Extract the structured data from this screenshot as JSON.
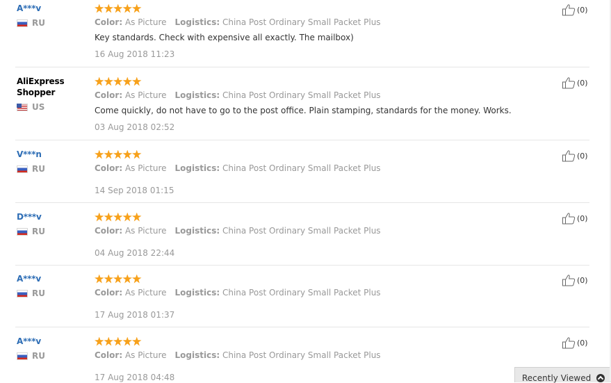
{
  "feedback": [
    {
      "user": "A***v",
      "user_link": true,
      "country_code": "RU",
      "flag": "ru",
      "stars": 5,
      "color_label": "Color:",
      "color_value": "As Picture",
      "logistics_label": "Logistics:",
      "logistics_value": "China Post Ordinary Small Packet Plus",
      "text": "Key standards. Check with expensive all exactly. The mailbox)",
      "date": "16 Aug 2018 11:23",
      "helpful_count": "(0)"
    },
    {
      "user": "AliExpress\nShopper",
      "user_link": false,
      "country_code": "US",
      "flag": "us",
      "stars": 5,
      "color_label": "Color:",
      "color_value": "As Picture",
      "logistics_label": "Logistics:",
      "logistics_value": "China Post Ordinary Small Packet Plus",
      "text": "Come quickly, do not have to go to the post office. Plain stamping, standards for the money. Works.",
      "date": "03 Aug 2018 02:52",
      "helpful_count": "(0)"
    },
    {
      "user": "V***n",
      "user_link": true,
      "country_code": "RU",
      "flag": "ru",
      "stars": 5,
      "color_label": "Color:",
      "color_value": "As Picture",
      "logistics_label": "Logistics:",
      "logistics_value": "China Post Ordinary Small Packet Plus",
      "text": "",
      "date": "14 Sep 2018 01:15",
      "helpful_count": "(0)"
    },
    {
      "user": "D***v",
      "user_link": true,
      "country_code": "RU",
      "flag": "ru",
      "stars": 5,
      "color_label": "Color:",
      "color_value": "As Picture",
      "logistics_label": "Logistics:",
      "logistics_value": "China Post Ordinary Small Packet Plus",
      "text": "",
      "date": "04 Aug 2018 22:44",
      "helpful_count": "(0)"
    },
    {
      "user": "A***v",
      "user_link": true,
      "country_code": "RU",
      "flag": "ru",
      "stars": 5,
      "color_label": "Color:",
      "color_value": "As Picture",
      "logistics_label": "Logistics:",
      "logistics_value": "China Post Ordinary Small Packet Plus",
      "text": "",
      "date": "17 Aug 2018 01:37",
      "helpful_count": "(0)"
    },
    {
      "user": "A***v",
      "user_link": true,
      "country_code": "RU",
      "flag": "ru",
      "stars": 5,
      "color_label": "Color:",
      "color_value": "As Picture",
      "logistics_label": "Logistics:",
      "logistics_value": "China Post Ordinary Small Packet Plus",
      "text": "",
      "date": "17 Aug 2018 04:48",
      "helpful_count": "(0)"
    }
  ],
  "recently_viewed": {
    "label": "Recently Viewed",
    "icon": "chevron-up-circle-icon"
  },
  "colors": {
    "star": "#f7a11b",
    "username_link": "#2d6db5",
    "muted_text": "#999999",
    "body_text": "#333333",
    "separator": "#e6e6e6"
  }
}
